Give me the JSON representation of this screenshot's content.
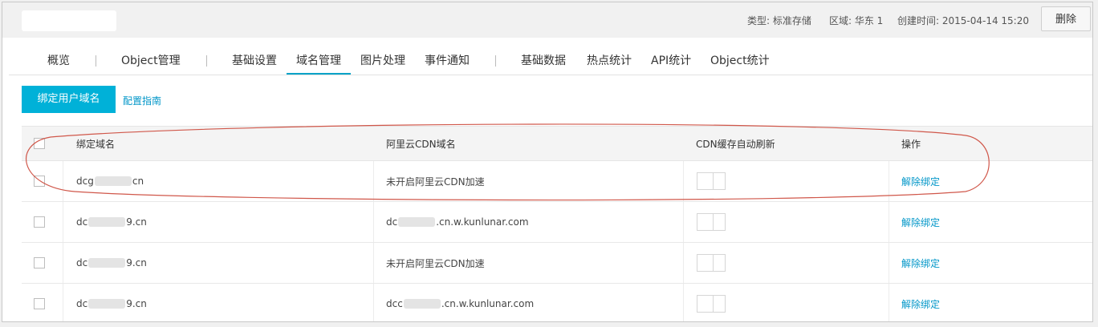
{
  "header": {
    "type_label": "类型: 标准存储",
    "region_label": "区域: 华东 1",
    "created_label": "创建时间: 2015-04-14 15:20",
    "delete_button": "删除"
  },
  "tabs": [
    {
      "label": "概览"
    },
    {
      "label": "Object管理"
    },
    {
      "label": "基础设置"
    },
    {
      "label": "域名管理"
    },
    {
      "label": "图片处理"
    },
    {
      "label": "事件通知"
    },
    {
      "label": "基础数据"
    },
    {
      "label": "热点统计"
    },
    {
      "label": "API统计"
    },
    {
      "label": "Object统计"
    }
  ],
  "actions": {
    "bind_button": "绑定用户域名",
    "guide_link": "配置指南"
  },
  "table": {
    "columns": [
      "绑定域名",
      "阿里云CDN域名",
      "CDN缓存自动刷新",
      "操作"
    ],
    "rows": [
      {
        "domain_pre": "dcg",
        "domain_post": "cn",
        "cdn_pre": "未开启阿里云CDN加速",
        "cdn_post": "",
        "action": "解除绑定"
      },
      {
        "domain_pre": "dc",
        "domain_post": "9.cn",
        "cdn_pre": "dc",
        "cdn_post": ".cn.w.kunlunar.com",
        "action": "解除绑定"
      },
      {
        "domain_pre": "dc",
        "domain_post": "9.cn",
        "cdn_pre": "未开启阿里云CDN加速",
        "cdn_post": "",
        "action": "解除绑定"
      },
      {
        "domain_pre": "dc",
        "domain_post": "9.cn",
        "cdn_pre": "dcc",
        "cdn_post": ".cn.w.kunlunar.com",
        "action": "解除绑定"
      }
    ]
  },
  "colors": {
    "accent": "#00b1d8",
    "link": "#0096c8",
    "annotation": "#d0574a"
  }
}
